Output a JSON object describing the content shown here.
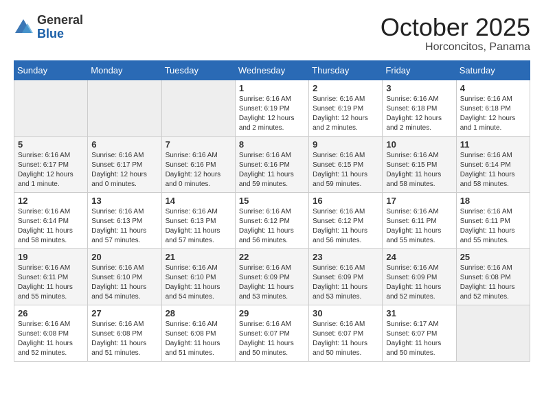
{
  "header": {
    "logo_general": "General",
    "logo_blue": "Blue",
    "title": "October 2025",
    "subtitle": "Horconcitos, Panama"
  },
  "days_of_week": [
    "Sunday",
    "Monday",
    "Tuesday",
    "Wednesday",
    "Thursday",
    "Friday",
    "Saturday"
  ],
  "weeks": [
    [
      {
        "day": "",
        "empty": true
      },
      {
        "day": "",
        "empty": true
      },
      {
        "day": "",
        "empty": true
      },
      {
        "day": "1",
        "sunrise": "Sunrise: 6:16 AM",
        "sunset": "Sunset: 6:19 PM",
        "daylight": "Daylight: 12 hours and 2 minutes."
      },
      {
        "day": "2",
        "sunrise": "Sunrise: 6:16 AM",
        "sunset": "Sunset: 6:19 PM",
        "daylight": "Daylight: 12 hours and 2 minutes."
      },
      {
        "day": "3",
        "sunrise": "Sunrise: 6:16 AM",
        "sunset": "Sunset: 6:18 PM",
        "daylight": "Daylight: 12 hours and 2 minutes."
      },
      {
        "day": "4",
        "sunrise": "Sunrise: 6:16 AM",
        "sunset": "Sunset: 6:18 PM",
        "daylight": "Daylight: 12 hours and 1 minute."
      }
    ],
    [
      {
        "day": "5",
        "sunrise": "Sunrise: 6:16 AM",
        "sunset": "Sunset: 6:17 PM",
        "daylight": "Daylight: 12 hours and 1 minute."
      },
      {
        "day": "6",
        "sunrise": "Sunrise: 6:16 AM",
        "sunset": "Sunset: 6:17 PM",
        "daylight": "Daylight: 12 hours and 0 minutes."
      },
      {
        "day": "7",
        "sunrise": "Sunrise: 6:16 AM",
        "sunset": "Sunset: 6:16 PM",
        "daylight": "Daylight: 12 hours and 0 minutes."
      },
      {
        "day": "8",
        "sunrise": "Sunrise: 6:16 AM",
        "sunset": "Sunset: 6:16 PM",
        "daylight": "Daylight: 11 hours and 59 minutes."
      },
      {
        "day": "9",
        "sunrise": "Sunrise: 6:16 AM",
        "sunset": "Sunset: 6:15 PM",
        "daylight": "Daylight: 11 hours and 59 minutes."
      },
      {
        "day": "10",
        "sunrise": "Sunrise: 6:16 AM",
        "sunset": "Sunset: 6:15 PM",
        "daylight": "Daylight: 11 hours and 58 minutes."
      },
      {
        "day": "11",
        "sunrise": "Sunrise: 6:16 AM",
        "sunset": "Sunset: 6:14 PM",
        "daylight": "Daylight: 11 hours and 58 minutes."
      }
    ],
    [
      {
        "day": "12",
        "sunrise": "Sunrise: 6:16 AM",
        "sunset": "Sunset: 6:14 PM",
        "daylight": "Daylight: 11 hours and 58 minutes."
      },
      {
        "day": "13",
        "sunrise": "Sunrise: 6:16 AM",
        "sunset": "Sunset: 6:13 PM",
        "daylight": "Daylight: 11 hours and 57 minutes."
      },
      {
        "day": "14",
        "sunrise": "Sunrise: 6:16 AM",
        "sunset": "Sunset: 6:13 PM",
        "daylight": "Daylight: 11 hours and 57 minutes."
      },
      {
        "day": "15",
        "sunrise": "Sunrise: 6:16 AM",
        "sunset": "Sunset: 6:12 PM",
        "daylight": "Daylight: 11 hours and 56 minutes."
      },
      {
        "day": "16",
        "sunrise": "Sunrise: 6:16 AM",
        "sunset": "Sunset: 6:12 PM",
        "daylight": "Daylight: 11 hours and 56 minutes."
      },
      {
        "day": "17",
        "sunrise": "Sunrise: 6:16 AM",
        "sunset": "Sunset: 6:11 PM",
        "daylight": "Daylight: 11 hours and 55 minutes."
      },
      {
        "day": "18",
        "sunrise": "Sunrise: 6:16 AM",
        "sunset": "Sunset: 6:11 PM",
        "daylight": "Daylight: 11 hours and 55 minutes."
      }
    ],
    [
      {
        "day": "19",
        "sunrise": "Sunrise: 6:16 AM",
        "sunset": "Sunset: 6:11 PM",
        "daylight": "Daylight: 11 hours and 55 minutes."
      },
      {
        "day": "20",
        "sunrise": "Sunrise: 6:16 AM",
        "sunset": "Sunset: 6:10 PM",
        "daylight": "Daylight: 11 hours and 54 minutes."
      },
      {
        "day": "21",
        "sunrise": "Sunrise: 6:16 AM",
        "sunset": "Sunset: 6:10 PM",
        "daylight": "Daylight: 11 hours and 54 minutes."
      },
      {
        "day": "22",
        "sunrise": "Sunrise: 6:16 AM",
        "sunset": "Sunset: 6:09 PM",
        "daylight": "Daylight: 11 hours and 53 minutes."
      },
      {
        "day": "23",
        "sunrise": "Sunrise: 6:16 AM",
        "sunset": "Sunset: 6:09 PM",
        "daylight": "Daylight: 11 hours and 53 minutes."
      },
      {
        "day": "24",
        "sunrise": "Sunrise: 6:16 AM",
        "sunset": "Sunset: 6:09 PM",
        "daylight": "Daylight: 11 hours and 52 minutes."
      },
      {
        "day": "25",
        "sunrise": "Sunrise: 6:16 AM",
        "sunset": "Sunset: 6:08 PM",
        "daylight": "Daylight: 11 hours and 52 minutes."
      }
    ],
    [
      {
        "day": "26",
        "sunrise": "Sunrise: 6:16 AM",
        "sunset": "Sunset: 6:08 PM",
        "daylight": "Daylight: 11 hours and 52 minutes."
      },
      {
        "day": "27",
        "sunrise": "Sunrise: 6:16 AM",
        "sunset": "Sunset: 6:08 PM",
        "daylight": "Daylight: 11 hours and 51 minutes."
      },
      {
        "day": "28",
        "sunrise": "Sunrise: 6:16 AM",
        "sunset": "Sunset: 6:08 PM",
        "daylight": "Daylight: 11 hours and 51 minutes."
      },
      {
        "day": "29",
        "sunrise": "Sunrise: 6:16 AM",
        "sunset": "Sunset: 6:07 PM",
        "daylight": "Daylight: 11 hours and 50 minutes."
      },
      {
        "day": "30",
        "sunrise": "Sunrise: 6:16 AM",
        "sunset": "Sunset: 6:07 PM",
        "daylight": "Daylight: 11 hours and 50 minutes."
      },
      {
        "day": "31",
        "sunrise": "Sunrise: 6:17 AM",
        "sunset": "Sunset: 6:07 PM",
        "daylight": "Daylight: 11 hours and 50 minutes."
      },
      {
        "day": "",
        "empty": true
      }
    ]
  ]
}
